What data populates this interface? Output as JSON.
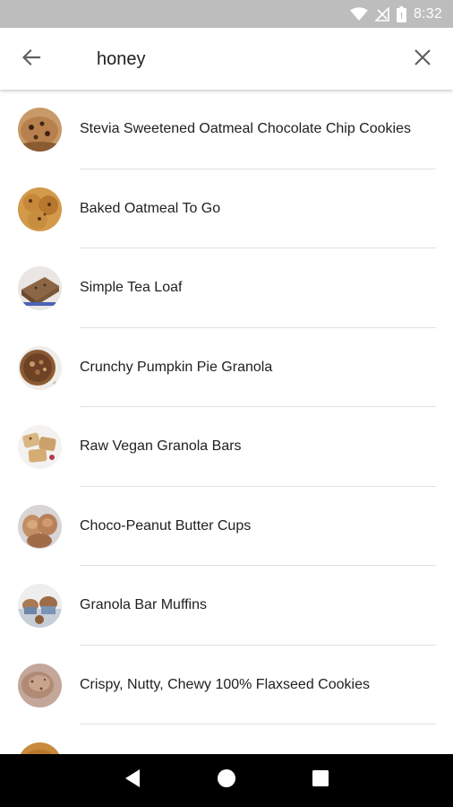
{
  "status_bar": {
    "time": "8:32",
    "icons": [
      "wifi-icon",
      "signal-off-icon",
      "battery-icon"
    ]
  },
  "search": {
    "query": "honey",
    "back_icon": "arrow-back-icon",
    "clear_icon": "close-icon"
  },
  "results": [
    {
      "title": "Stevia Sweetened Oatmeal Chocolate Chip Cookies",
      "thumb": "cookie-thumbnail"
    },
    {
      "title": "Baked Oatmeal To Go",
      "thumb": "baked-oatmeal-thumbnail"
    },
    {
      "title": "Simple Tea Loaf",
      "thumb": "tea-loaf-thumbnail"
    },
    {
      "title": "Crunchy Pumpkin Pie Granola",
      "thumb": "granola-bowl-thumbnail"
    },
    {
      "title": "Raw Vegan Granola Bars",
      "thumb": "granola-bars-thumbnail"
    },
    {
      "title": "Choco-Peanut Butter Cups",
      "thumb": "peanut-butter-cups-thumbnail"
    },
    {
      "title": "Granola Bar Muffins",
      "thumb": "muffins-thumbnail"
    },
    {
      "title": "Crispy, Nutty, Chewy 100% Flaxseed Cookies",
      "thumb": "flaxseed-cookies-thumbnail"
    },
    {
      "title": "",
      "thumb": "partial-thumbnail"
    }
  ],
  "nav_bar": {
    "icons": [
      "back-triangle-icon",
      "home-circle-icon",
      "recents-square-icon"
    ]
  },
  "colors": {
    "status_bar_bg": "#bdbdbd",
    "text": "#212121",
    "icon": "#616161",
    "divider": "#e0e0e0",
    "nav_bar_bg": "#000000"
  }
}
